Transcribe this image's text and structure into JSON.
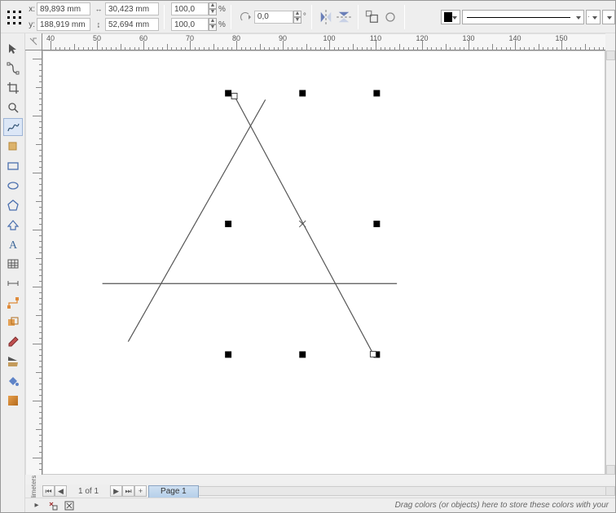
{
  "propbar": {
    "pos": {
      "x_label": "x:",
      "y_label": "y:",
      "x": "89,893 mm",
      "y": "188,919 mm"
    },
    "size": {
      "w_icon": "↔",
      "h_icon": "↨",
      "w": "30,423 mm",
      "h": "52,694 mm"
    },
    "scale": {
      "sx": "100,0",
      "sy": "100,0",
      "unit": "%"
    },
    "rotation": "0,0",
    "units_label": "°"
  },
  "tools": [
    {
      "id": "pick-tool",
      "selected": false
    },
    {
      "id": "shape-tool",
      "selected": false
    },
    {
      "id": "crop-tool",
      "selected": false
    },
    {
      "id": "zoom-tool",
      "selected": false
    },
    {
      "id": "freehand-tool",
      "selected": true
    },
    {
      "id": "smart-fill-tool",
      "selected": false
    },
    {
      "id": "rectangle-tool",
      "selected": false
    },
    {
      "id": "ellipse-tool",
      "selected": false
    },
    {
      "id": "polygon-tool",
      "selected": false
    },
    {
      "id": "basic-shapes-tool",
      "selected": false
    },
    {
      "id": "text-tool",
      "selected": false
    },
    {
      "id": "table-tool",
      "selected": false
    },
    {
      "id": "dimension-tool",
      "selected": false
    },
    {
      "id": "connector-tool",
      "selected": false
    },
    {
      "id": "effects-tool",
      "selected": false
    },
    {
      "id": "eyedropper-tool",
      "selected": false
    },
    {
      "id": "outline-tool",
      "selected": false
    },
    {
      "id": "fill-tool",
      "selected": false
    },
    {
      "id": "interactive-fill-tool",
      "selected": false
    }
  ],
  "ruler_h": {
    "start": 40,
    "end": 150,
    "step": 10
  },
  "ruler_v": {
    "start": 220,
    "end": 150,
    "step": -10
  },
  "nav": {
    "units": "millimeters",
    "first": "⏮",
    "prev": "◀",
    "info": "1 of 1",
    "next": "▶",
    "last": "⏭",
    "add": "+",
    "tab": "Page 1"
  },
  "hint": "Drag colors (or objects) here to store these colors with your"
}
